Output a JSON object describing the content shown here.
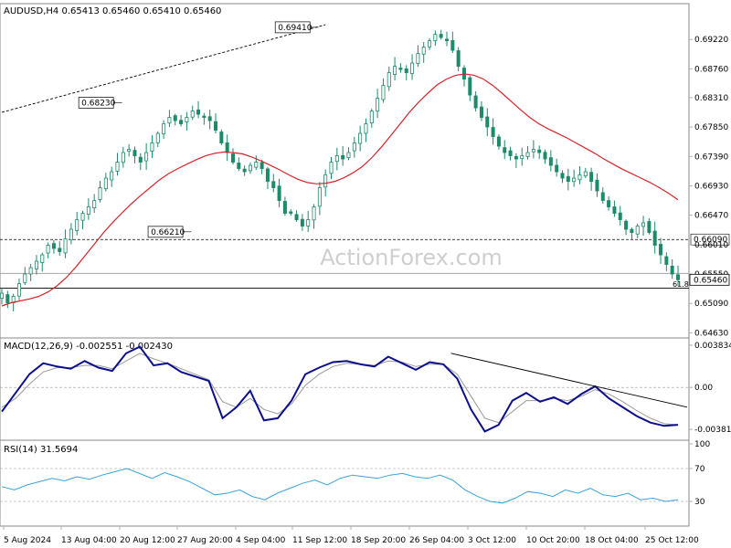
{
  "colors": {
    "background": "#ffffff",
    "candle": "#1d8a6a",
    "ma": "#d6242a",
    "macd": "#0b0f8c",
    "signal": "#9a9a9a",
    "rsi": "#3aa3d8",
    "trend": "#000000",
    "grid": "#b0b0b0",
    "text": "#000000",
    "watermark": "#cfcfcf"
  },
  "watermark": "ActionForex.com",
  "chart_data": [
    {
      "id": "price",
      "type": "candlestick",
      "title": "AUDUSD,H4  0.65413 0.65460 0.65410 0.65460",
      "ylim": [
        0.6455,
        0.6978
      ],
      "yticks": [
        "0.69220",
        "0.68760",
        "0.68310",
        "0.67850",
        "0.67390",
        "0.66930",
        "0.66470",
        "0.66010",
        "0.65550",
        "0.65090",
        "0.64630"
      ],
      "current_price_label": "0.65460",
      "series": [
        {
          "name": "",
          "description": "close path, 3 Aug - 30 Oct",
          "values": [
            0.6525,
            0.651,
            0.652,
            0.654,
            0.6555,
            0.6565,
            0.6575,
            0.6585,
            0.66,
            0.6595,
            0.659,
            0.661,
            0.6625,
            0.664,
            0.665,
            0.666,
            0.667,
            0.669,
            0.6705,
            0.6715,
            0.673,
            0.6745,
            0.675,
            0.674,
            0.673,
            0.6745,
            0.676,
            0.6775,
            0.679,
            0.68,
            0.6795,
            0.679,
            0.68,
            0.681,
            0.6805,
            0.68,
            0.6795,
            0.678,
            0.676,
            0.6745,
            0.673,
            0.672,
            0.6715,
            0.6725,
            0.673,
            0.672,
            0.67,
            0.669,
            0.667,
            0.665,
            0.665,
            0.664,
            0.663,
            0.664,
            0.666,
            0.669,
            0.671,
            0.673,
            0.674,
            0.6735,
            0.6745,
            0.676,
            0.6775,
            0.679,
            0.681,
            0.683,
            0.685,
            0.687,
            0.688,
            0.6875,
            0.687,
            0.6885,
            0.69,
            0.691,
            0.692,
            0.693,
            0.6925,
            0.692,
            0.6905,
            0.688,
            0.686,
            0.6835,
            0.6815,
            0.68,
            0.6785,
            0.677,
            0.6755,
            0.6745,
            0.674,
            0.6735,
            0.674,
            0.6745,
            0.675,
            0.6745,
            0.6735,
            0.6725,
            0.6715,
            0.6705,
            0.67,
            0.6705,
            0.671,
            0.6715,
            0.67,
            0.6685,
            0.667,
            0.666,
            0.665,
            0.664,
            0.6625,
            0.662,
            0.663,
            0.6635,
            0.662,
            0.66,
            0.6585,
            0.657,
            0.6555,
            0.6546
          ]
        },
        {
          "name": "",
          "description": "moving average",
          "values": [
            0.6505,
            0.651,
            0.6513,
            0.6516,
            0.652,
            0.6527,
            0.6537,
            0.655,
            0.6566,
            0.6584,
            0.6602,
            0.662,
            0.6636,
            0.6651,
            0.6665,
            0.6678,
            0.669,
            0.6702,
            0.6712,
            0.672,
            0.6727,
            0.6734,
            0.674,
            0.6744,
            0.6746,
            0.6745,
            0.6743,
            0.6738,
            0.6732,
            0.6725,
            0.6718,
            0.671,
            0.6703,
            0.6698,
            0.6696,
            0.6697,
            0.67,
            0.6706,
            0.6714,
            0.6724,
            0.6738,
            0.6754,
            0.6772,
            0.679,
            0.6808,
            0.6824,
            0.6838,
            0.6851,
            0.686,
            0.6866,
            0.6868,
            0.6866,
            0.686,
            0.685,
            0.6838,
            0.6825,
            0.6812,
            0.68,
            0.679,
            0.6782,
            0.6775,
            0.6768,
            0.676,
            0.6752,
            0.6744,
            0.6735,
            0.6727,
            0.6719,
            0.6712,
            0.6705,
            0.6698,
            0.669,
            0.6681,
            0.6671
          ]
        }
      ],
      "levels": [
        {
          "value": 0.6609,
          "label": "0.66090",
          "style": "dotted"
        },
        {
          "value": 0.6556,
          "label": "",
          "style": "thin"
        },
        {
          "value": 0.6533,
          "label": "",
          "style": "solid"
        }
      ],
      "annotations": [
        {
          "label": "0.69410",
          "at": [
            53,
            0.6941
          ]
        },
        {
          "label": "0.68230",
          "at": [
            19,
            0.6823
          ]
        },
        {
          "label": "0.66210",
          "at": [
            31,
            0.6621
          ]
        },
        {
          "label": "61.8",
          "at": [
            88,
            0.6532
          ]
        }
      ],
      "trendlines": [
        {
          "from": [
            0,
            0.6808
          ],
          "to": [
            56,
            0.6945
          ],
          "style": "dotted"
        }
      ],
      "xlabels": [
        "5 Aug 2024",
        "13 Aug 04:00",
        "20 Aug 12:00",
        "27 Aug 20:00",
        "4 Sep 04:00",
        "11 Sep 12:00",
        "18 Sep 20:00",
        "26 Sep 04:00",
        "3 Oct 12:00",
        "10 Oct 20:00",
        "18 Oct 04:00",
        "25 Oct 12:00"
      ]
    },
    {
      "id": "macd",
      "type": "line",
      "title": "MACD(12,26,9) -0.002551 -0.002430",
      "ylim": [
        -0.0048,
        0.0045
      ],
      "yticks": [
        "0.003834",
        "0.00",
        "-0.003811"
      ],
      "series": [
        {
          "name": "",
          "values": [
            -0.0022,
            -0.0005,
            0.0012,
            0.0022,
            0.0019,
            0.0017,
            0.0024,
            0.0018,
            0.0015,
            0.0031,
            0.0037,
            0.002,
            0.0022,
            0.0014,
            0.001,
            0.0006,
            -0.0028,
            -0.0018,
            -0.0003,
            -0.003,
            -0.0028,
            -0.0012,
            0.0012,
            0.0018,
            0.0023,
            0.0024,
            0.0021,
            0.0019,
            0.0028,
            0.0022,
            0.0016,
            0.0023,
            0.0021,
            0.0008,
            -0.002,
            -0.004,
            -0.0034,
            -0.0012,
            -0.0005,
            -0.0013,
            -0.0009,
            -0.0015,
            -0.0006,
            0.0001,
            -0.001,
            -0.0018,
            -0.0026,
            -0.0032,
            -0.0035,
            -0.0034
          ]
        },
        {
          "name": "",
          "values": [
            -0.0018,
            -0.001,
            0.0003,
            0.0014,
            0.0018,
            0.0018,
            0.002,
            0.002,
            0.0017,
            0.0024,
            0.0031,
            0.0026,
            0.0022,
            0.0017,
            0.0012,
            0.0007,
            -0.0013,
            -0.0018,
            -0.001,
            -0.002,
            -0.0024,
            -0.0015,
            0.0002,
            0.0012,
            0.0019,
            0.0022,
            0.0021,
            0.002,
            0.0024,
            0.0023,
            0.0019,
            0.0021,
            0.0021,
            0.0012,
            -0.0008,
            -0.0028,
            -0.0032,
            -0.0022,
            -0.0012,
            -0.0012,
            -0.001,
            -0.0012,
            -0.0008,
            -0.0002,
            -0.0006,
            -0.0013,
            -0.0021,
            -0.0028,
            -0.0033,
            -0.0034
          ]
        }
      ],
      "trendlines": [
        {
          "from": [
            0.64,
            0.0031
          ],
          "to": [
            1.0,
            -0.0018
          ],
          "style": "solid"
        }
      ]
    },
    {
      "id": "rsi",
      "type": "line",
      "title": "RSI(14) 31.5694",
      "ylim": [
        0,
        100
      ],
      "yticks": [
        "100",
        "70",
        "30",
        "0"
      ],
      "levels": [
        {
          "value": 70,
          "label": "",
          "style": "dotted"
        },
        {
          "value": 30,
          "label": "",
          "style": "dotted"
        }
      ],
      "series": [
        {
          "name": "",
          "values": [
            48,
            44,
            50,
            54,
            58,
            55,
            60,
            57,
            62,
            66,
            70,
            64,
            58,
            65,
            60,
            54,
            46,
            38,
            40,
            44,
            36,
            32,
            40,
            46,
            52,
            56,
            50,
            58,
            62,
            60,
            58,
            62,
            64,
            60,
            58,
            62,
            56,
            44,
            36,
            30,
            28,
            34,
            42,
            40,
            36,
            44,
            40,
            46,
            38,
            36,
            40,
            32,
            34,
            30,
            32
          ]
        }
      ]
    }
  ]
}
